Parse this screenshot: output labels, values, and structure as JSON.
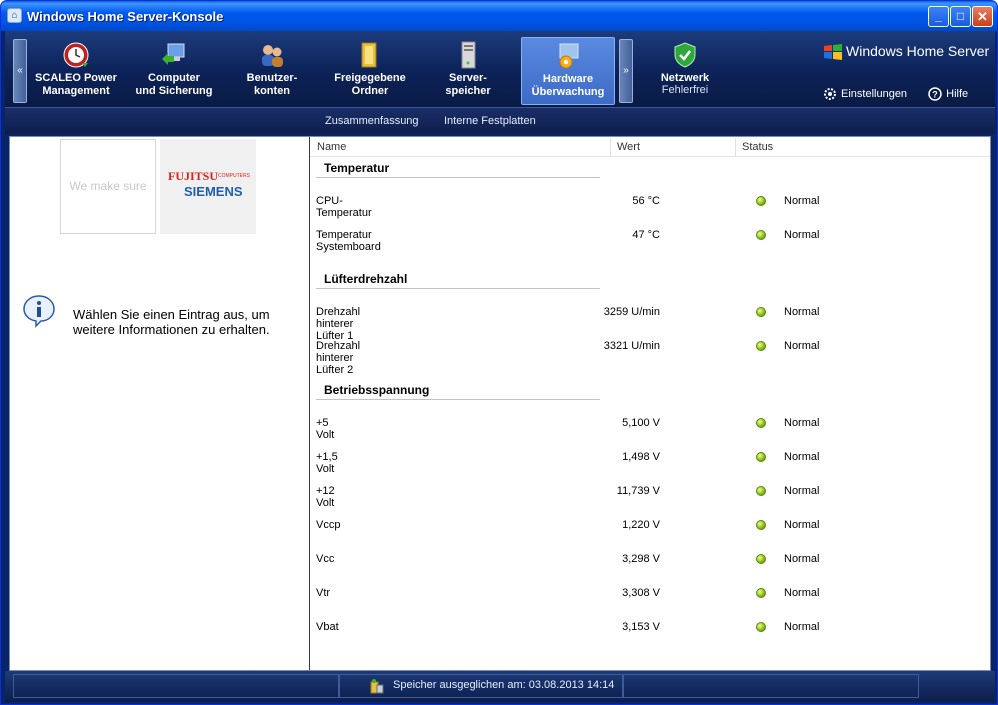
{
  "window": {
    "title": "Windows Home Server-Konsole",
    "title_icon": "console-app-icon"
  },
  "nav": {
    "tabs": [
      {
        "label": "SCALEO Power\nManagement",
        "icon": "power-clock-icon"
      },
      {
        "label": "Computer\nund Sicherung",
        "icon": "computer-icon"
      },
      {
        "label": "Benutzer-\nkonten",
        "icon": "users-icon"
      },
      {
        "label": "Freigegebene\nOrdner",
        "icon": "folder-icon"
      },
      {
        "label": "Server-\nspeicher",
        "icon": "server-icon"
      },
      {
        "label": "Hardware\nÜberwachung",
        "icon": "hardware-gear-icon"
      }
    ],
    "network": {
      "title": "Netzwerk",
      "status": "Fehlerfrei",
      "icon": "shield-check-icon"
    },
    "brand": "Windows Home Server",
    "settings": "Einstellungen",
    "help": "Hilfe"
  },
  "subnav": {
    "summary": "Zusammenfassung",
    "internal_disks": "Interne Festplatten"
  },
  "left": {
    "logo1_text": "We make sure",
    "fujitsu": "FUJITSU",
    "computers": "COMPUTERS",
    "siemens": "SIEMENS",
    "info_text": "Wählen Sie einen Eintrag aus, um weitere Informationen zu erhalten."
  },
  "table": {
    "headers": {
      "name": "Name",
      "value": "Wert",
      "status": "Status"
    },
    "groups": [
      {
        "title": "Temperatur",
        "rows": [
          {
            "name": "CPU-Temperatur",
            "value": "56 °C",
            "status": "Normal"
          },
          {
            "name": "Temperatur Systemboard",
            "value": "47 °C",
            "status": "Normal"
          }
        ]
      },
      {
        "title": "Lüfterdrehzahl",
        "rows": [
          {
            "name": "Drehzahl hinterer Lüfter 1",
            "value": "3259 U/min",
            "status": "Normal"
          },
          {
            "name": "Drehzahl hinterer Lüfter 2",
            "value": "3321 U/min",
            "status": "Normal"
          }
        ]
      },
      {
        "title": "Betriebsspannung",
        "rows": [
          {
            "name": "+5 Volt",
            "value": "5,100 V",
            "status": "Normal"
          },
          {
            "name": "+1,5 Volt",
            "value": "1,498 V",
            "status": "Normal"
          },
          {
            "name": "+12 Volt",
            "value": "11,739 V",
            "status": "Normal"
          },
          {
            "name": "Vccp",
            "value": "1,220 V",
            "status": "Normal"
          },
          {
            "name": "Vcc",
            "value": "3,298 V",
            "status": "Normal"
          },
          {
            "name": "Vtr",
            "value": "3,308 V",
            "status": "Normal"
          },
          {
            "name": "Vbat",
            "value": "3,153 V",
            "status": "Normal"
          }
        ]
      }
    ]
  },
  "statusbar": {
    "text": "Speicher ausgeglichen am: 03.08.2013 14:14"
  },
  "colors": {
    "status_ok": "#8cbf1a",
    "nav_active": "#3c6ac8"
  }
}
